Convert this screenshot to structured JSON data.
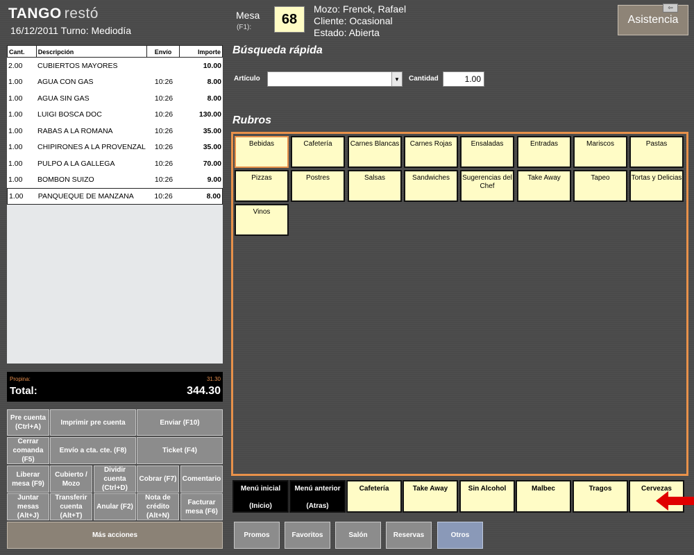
{
  "header": {
    "brand": "TANGO",
    "product": "restó",
    "date_shift": "16/12/2011 Turno: Mediodía",
    "mesa_label": "Mesa",
    "mesa_hint": "(F1):",
    "mesa_number": "68",
    "mozo": "Mozo: Frenck, Rafael",
    "cliente": "Cliente: Ocasional",
    "estado": "Estado: Abierta",
    "asistencia": "Asistencia"
  },
  "order": {
    "columns": [
      "Cant.",
      "Descripción",
      "Envío",
      "Importe"
    ],
    "rows": [
      {
        "cant": "2.00",
        "desc": "CUBIERTOS MAYORES",
        "envio": "",
        "importe": "10.00"
      },
      {
        "cant": "1.00",
        "desc": "AGUA CON GAS",
        "envio": "10:26",
        "importe": "8.00"
      },
      {
        "cant": "1.00",
        "desc": "AGUA SIN GAS",
        "envio": "10:26",
        "importe": "8.00"
      },
      {
        "cant": "1.00",
        "desc": "LUIGI BOSCA DOC",
        "envio": "10:26",
        "importe": "130.00"
      },
      {
        "cant": "1.00",
        "desc": "RABAS A LA ROMANA",
        "envio": "10:26",
        "importe": "35.00"
      },
      {
        "cant": "1.00",
        "desc": "CHIPIRONES A LA PROVENZAL",
        "envio": "10:26",
        "importe": "35.00"
      },
      {
        "cant": "1.00",
        "desc": "PULPO A LA GALLEGA",
        "envio": "10:26",
        "importe": "70.00"
      },
      {
        "cant": "1.00",
        "desc": "BOMBON SUIZO",
        "envio": "10:26",
        "importe": "9.00"
      },
      {
        "cant": "1.00",
        "desc": "PANQUEQUE DE MANZANA",
        "envio": "10:26",
        "importe": "8.00"
      }
    ],
    "propina_label": "Propina:",
    "propina_value": "31.30",
    "total_label": "Total:",
    "total_value": "344.30"
  },
  "actions": {
    "pre_cuenta": "Pre cuenta (Ctrl+A)",
    "imprimir_pre_cuenta": "Imprimir pre cuenta",
    "enviar": "Enviar (F10)",
    "cerrar_comanda": "Cerrar comanda (F5)",
    "envio_cta": "Envío a cta. cte. (F8)",
    "ticket": "Ticket (F4)",
    "liberar_mesa": "Liberar mesa (F9)",
    "cubierto_mozo": "Cubierto / Mozo",
    "dividir_cuenta": "Dividir cuenta (Ctrl+D)",
    "cobrar": "Cobrar (F7)",
    "comentario": "Comentario",
    "juntar_mesas": "Juntar mesas (Alt+J)",
    "transferir_cuenta": "Transferir cuenta (Alt+T)",
    "anular": "Anular (F2)",
    "nota_credito": "Nota de crédito (Alt+N)",
    "facturar_mesa": "Facturar mesa (F6)",
    "mas_acciones": "Más acciones"
  },
  "busqueda": {
    "title": "Búsqueda rápida",
    "articulo_label": "Artículo",
    "articulo_value": "",
    "cantidad_label": "Cantidad",
    "cantidad_value": "1.00"
  },
  "rubros": {
    "title": "Rubros",
    "items": [
      "Bebidas",
      "Cafetería",
      "Carnes Blancas",
      "Carnes Rojas",
      "Ensaladas",
      "Entradas",
      "Mariscos",
      "Pastas",
      "Pizzas",
      "Postres",
      "Salsas",
      "Sandwiches",
      "Sugerencias del Chef",
      "Take Away",
      "Tapeo",
      "Tortas y Delicias",
      "Vinos"
    ]
  },
  "bottom_bar": {
    "menu_inicial": "Menú inicial",
    "menu_inicial_key": "(Inicio)",
    "menu_anterior": "Menú anterior",
    "menu_anterior_key": "(Atras)",
    "shortcuts": [
      "Cafetería",
      "Take Away",
      "Sin Alcohol",
      "Malbec",
      "Tragos",
      "Cervezas"
    ]
  },
  "tabs": [
    "Promos",
    "Favoritos",
    "Salón",
    "Reservas",
    "Otros"
  ],
  "colors": {
    "accent": "#e8914a",
    "button_yellow": "#fffcc6",
    "button_gray": "#8c8c8c",
    "active_tab": "#8a99b8",
    "arrow": "#e00000"
  }
}
